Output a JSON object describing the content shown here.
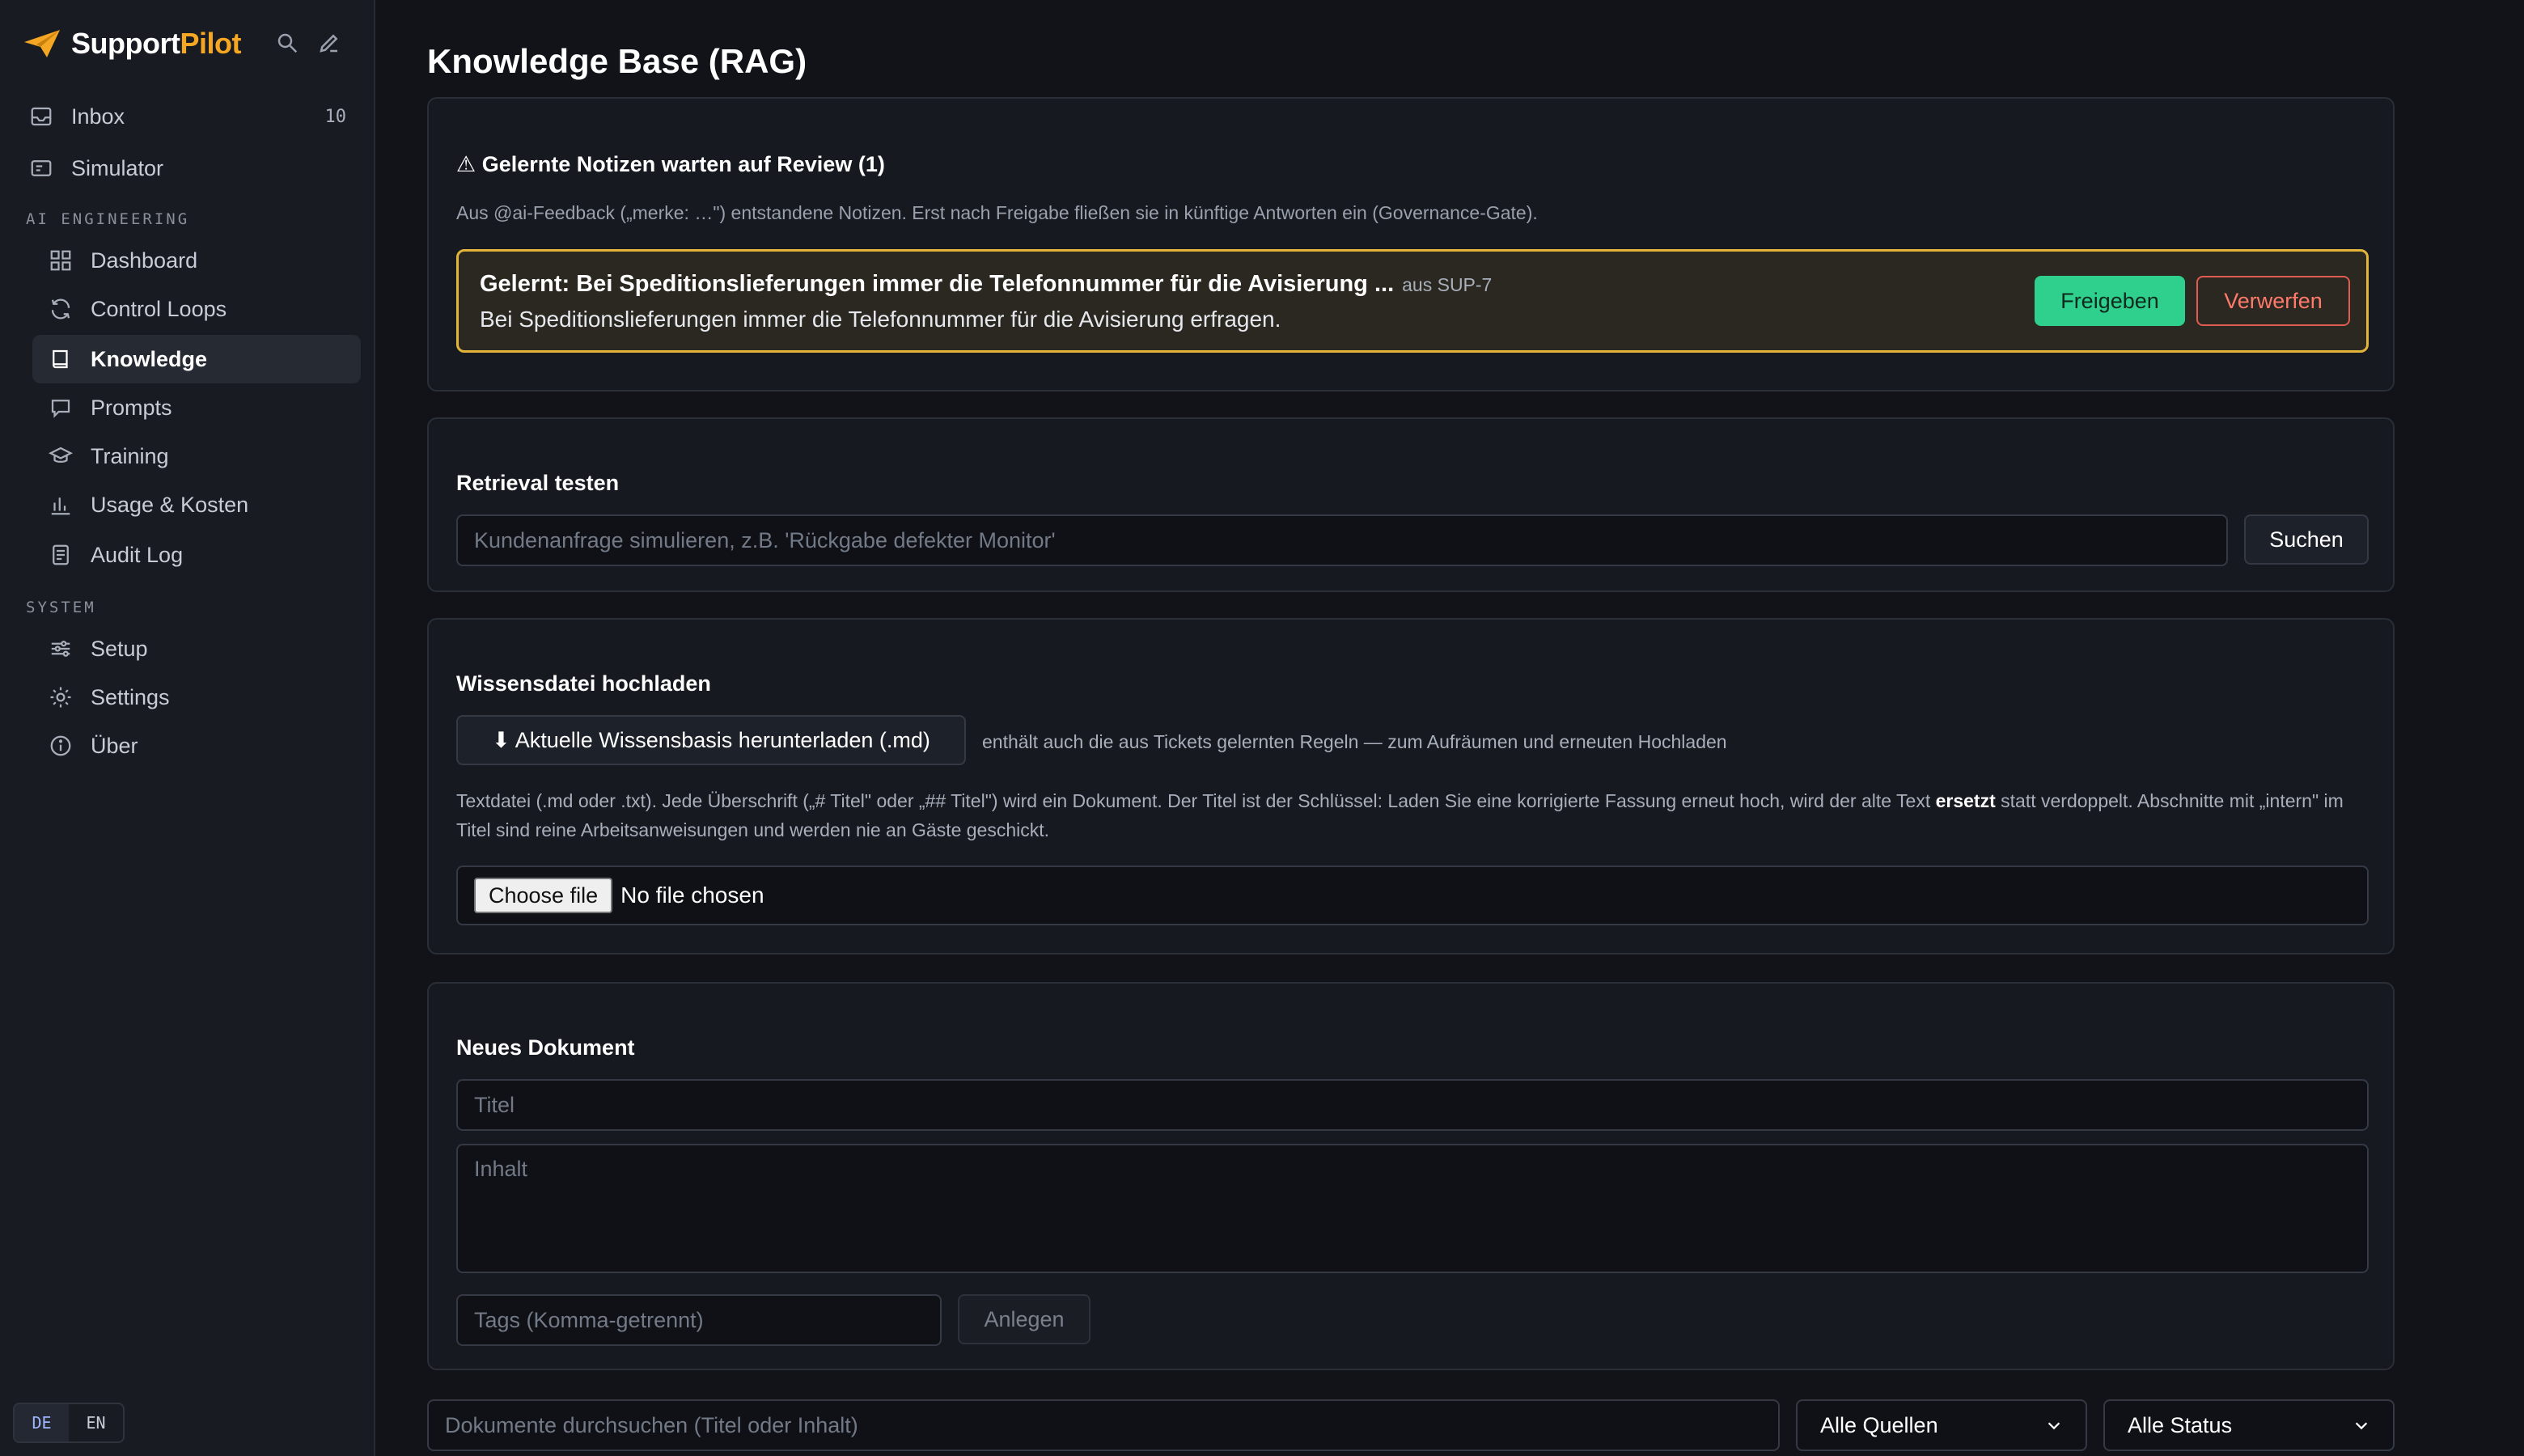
{
  "brand": {
    "name_part1": "Support",
    "name_part2": "Pilot",
    "accent_color": "#f5a623"
  },
  "sidebar": {
    "top_items": [
      {
        "label": "Inbox",
        "icon": "inbox-icon",
        "count": "10"
      },
      {
        "label": "Simulator",
        "icon": "monitor-icon"
      }
    ],
    "section_ai": "AI ENGINEERING",
    "ai_items": [
      {
        "label": "Dashboard",
        "icon": "grid-icon"
      },
      {
        "label": "Control Loops",
        "icon": "refresh-icon"
      },
      {
        "label": "Knowledge",
        "icon": "book-icon",
        "active": true
      },
      {
        "label": "Prompts",
        "icon": "chat-icon"
      },
      {
        "label": "Training",
        "icon": "graduation-cap-icon"
      },
      {
        "label": "Usage & Kosten",
        "icon": "bar-chart-icon"
      },
      {
        "label": "Audit Log",
        "icon": "document-icon"
      }
    ],
    "section_system": "SYSTEM",
    "system_items": [
      {
        "label": "Setup",
        "icon": "sliders-icon"
      },
      {
        "label": "Settings",
        "icon": "gear-icon"
      },
      {
        "label": "Über",
        "icon": "info-icon"
      }
    ],
    "lang": {
      "de": "DE",
      "en": "EN",
      "active": "DE"
    }
  },
  "main": {
    "title": "Knowledge Base (RAG)",
    "review": {
      "title": "⚠ Gelernte Notizen warten auf Review (1)",
      "description": "Aus @ai-Feedback („merke: …\") entstandene Notizen. Erst nach Freigabe fließen sie in künftige Antworten ein (Governance-Gate).",
      "item_title": "Gelernt: Bei Speditionslieferungen immer die Telefonnummer für die Avisierung ...",
      "item_source": "aus SUP-7",
      "item_text": "Bei Speditionslieferungen immer die Telefonnummer für die Avisierung erfragen.",
      "approve_label": "Freigeben",
      "reject_label": "Verwerfen",
      "highlight_color": "#e2b53a"
    },
    "retrieval": {
      "title": "Retrieval testen",
      "placeholder": "Kundenanfrage simulieren, z.B. 'Rückgabe defekter Monitor'",
      "button_label": "Suchen"
    },
    "upload": {
      "title": "Wissensdatei hochladen",
      "download_label": "⬇ Aktuelle Wissensbasis herunterladen (.md)",
      "download_hint": "enthält auch die aus Tickets gelernten Regeln — zum Aufräumen und erneuten Hochladen",
      "desc_part1": "Textdatei (.md oder .txt). Jede Überschrift („# Titel\" oder „## Titel\") wird ein Dokument. Der Titel ist der Schlüssel: Laden Sie eine korrigierte Fassung erneut hoch, wird der alte Text",
      "desc_bold": "ersetzt",
      "desc_part2": "statt verdoppelt. Abschnitte mit „intern\" im Titel sind reine Arbeitsanweisungen und werden nie an Gäste geschickt.",
      "file_button": "Choose file",
      "file_status": "No file chosen"
    },
    "new_doc": {
      "title": "Neues Dokument",
      "title_placeholder": "Titel",
      "content_placeholder": "Inhalt",
      "tags_placeholder": "Tags (Komma-getrennt)",
      "create_label": "Anlegen"
    },
    "filters": {
      "search_placeholder": "Dokumente durchsuchen (Titel oder Inhalt)",
      "source_selected": "Alle Quellen",
      "status_selected": "Alle Status"
    }
  }
}
